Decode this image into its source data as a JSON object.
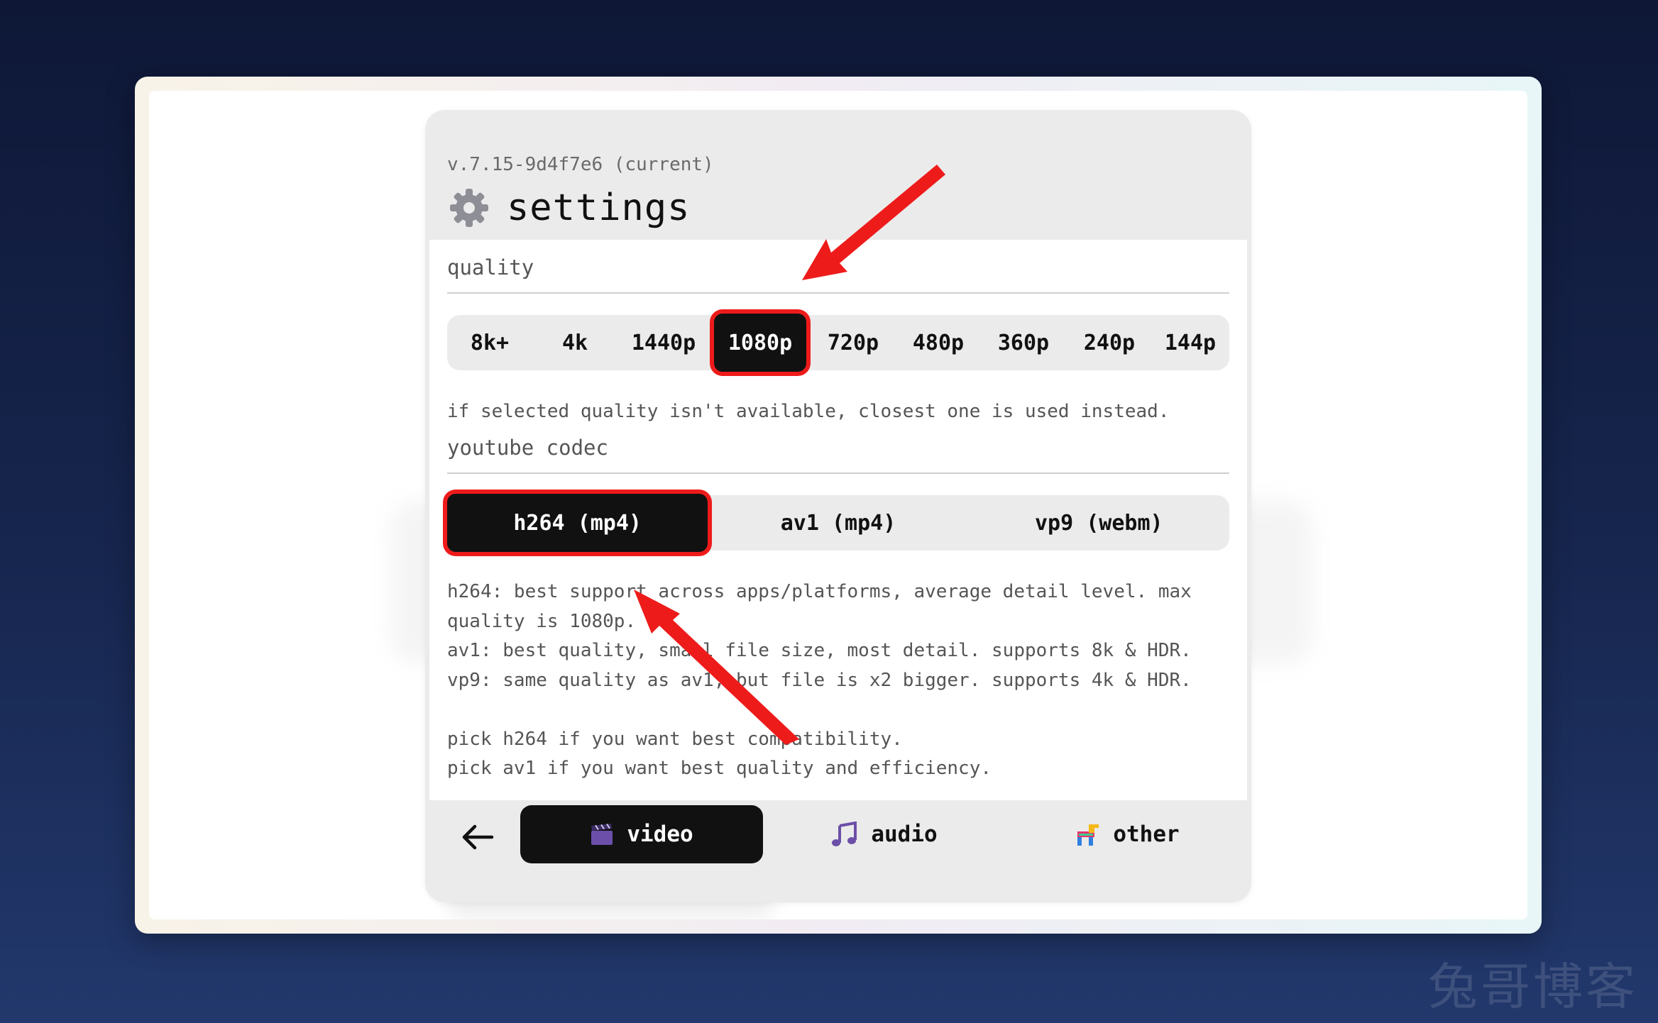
{
  "version": "v.7.15-9d4f7e6 (current)",
  "title": "settings",
  "quality": {
    "label": "quality",
    "options": [
      "8k+",
      "4k",
      "1440p",
      "1080p",
      "720p",
      "480p",
      "360p",
      "240p",
      "144p"
    ],
    "selected": "1080p",
    "note": "if selected quality isn't available, closest one is used instead."
  },
  "codec": {
    "label": "youtube codec",
    "options": [
      "h264 (mp4)",
      "av1 (mp4)",
      "vp9 (webm)"
    ],
    "selected": "h264 (mp4)",
    "notes": [
      "h264: best support across apps/platforms, average detail level. max",
      "quality is 1080p.",
      "av1: best quality, small file size, most detail. supports 8k & HDR.",
      "vp9: same quality as av1, but file is x2 bigger. supports 4k & HDR.",
      "",
      "pick h264 if you want best compatibility.",
      "pick av1 if you want best quality and efficiency."
    ]
  },
  "nav": {
    "tabs": [
      {
        "label": "video",
        "icon": "clapper-board-icon"
      },
      {
        "label": "audio",
        "icon": "musical-notes-icon"
      },
      {
        "label": "other",
        "icon": "pinata-icon"
      }
    ],
    "active": "video"
  },
  "watermark": "兔哥博客",
  "colors": {
    "highlight": "#ee1b1b",
    "active_bg": "#111111"
  }
}
